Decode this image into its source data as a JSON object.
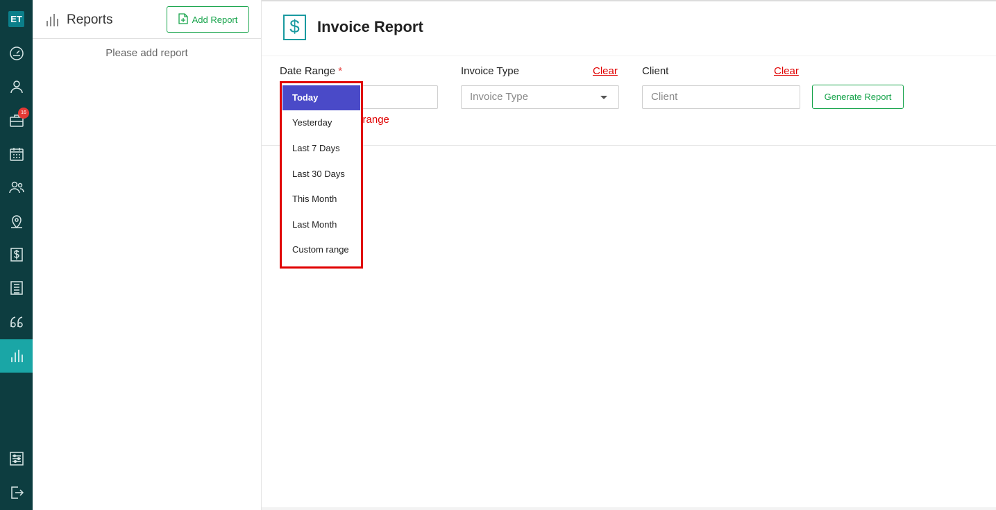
{
  "app": {
    "logo_text": "ET",
    "notification_count": "16"
  },
  "rail": {
    "items": [
      {
        "name": "dashboard-icon"
      },
      {
        "name": "user-icon"
      },
      {
        "name": "briefcase-icon"
      },
      {
        "name": "calendar-icon"
      },
      {
        "name": "users-icon"
      },
      {
        "name": "location-icon"
      },
      {
        "name": "dollar-icon"
      },
      {
        "name": "list-icon"
      },
      {
        "name": "quote-icon"
      },
      {
        "name": "reports-icon",
        "active": true
      },
      {
        "name": "settings-icon"
      },
      {
        "name": "logout-icon"
      }
    ]
  },
  "reports_panel": {
    "title": "Reports",
    "add_button": "Add Report",
    "empty_message": "Please add report"
  },
  "main": {
    "title": "Invoice Report",
    "date_range": {
      "label": "Date Range",
      "required_mark": "*",
      "placeholder_tail": "e",
      "error_tail": "e range"
    },
    "invoice_type": {
      "label": "Invoice Type",
      "clear": "Clear",
      "placeholder": "Invoice Type"
    },
    "client": {
      "label": "Client",
      "clear": "Clear",
      "placeholder": "Client"
    },
    "generate_button": "Generate Report"
  },
  "dropdown": {
    "options": [
      "Today",
      "Yesterday",
      "Last 7 Days",
      "Last 30 Days",
      "This Month",
      "Last Month",
      "Custom range"
    ],
    "selected": "Today"
  },
  "colors": {
    "rail_bg": "#0d3d40",
    "rail_active": "#1aa6a6",
    "accent_green": "#16a34a",
    "highlight": "#4a4ac8",
    "error_red": "#e00000"
  }
}
